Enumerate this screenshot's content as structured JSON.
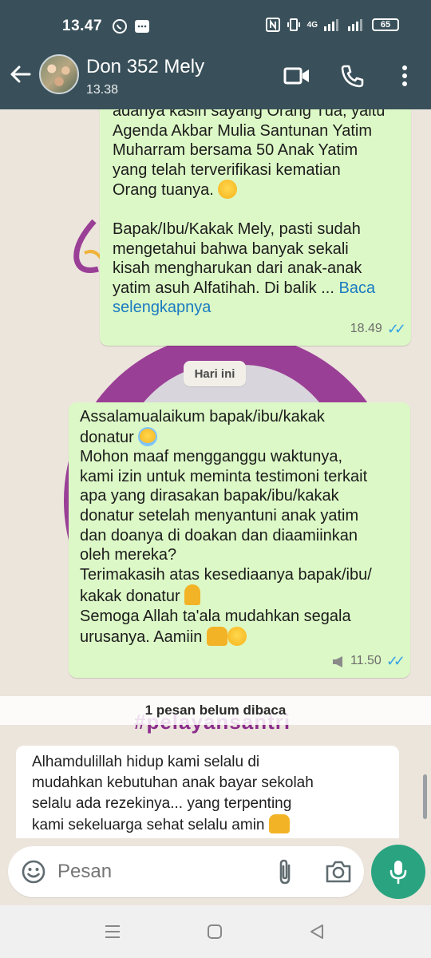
{
  "status_bar": {
    "time": "13.47",
    "battery": "65",
    "network": "4G"
  },
  "header": {
    "contact_name": "Don 352 Mely",
    "subtitle": "13.38"
  },
  "messages": [
    {
      "lines": [
        "adanya kasih sayang Orang Tua, yaitu",
        "Agenda Akbar Mulia Santunan Yatim",
        "Muharram bersama 50 Anak Yatim",
        "yang telah terverifikasi kematian",
        "Orang tuanya."
      ],
      "lines2": [
        "Bapak/Ibu/Kakak Mely, pasti sudah",
        "mengetahui bahwa banyak sekali",
        "kisah mengharukan dari anak-anak",
        "yatim asuh Alfatihah. Di balik ..."
      ],
      "read_more": "Baca selengkapnya",
      "time": "18.49"
    },
    {
      "lines": [
        "Assalamualaikum bapak/ibu/kakak",
        "donatur",
        "Mohon maaf mengganggu waktunya,",
        "kami izin untuk meminta testimoni terkait",
        "apa yang dirasakan bapak/ibu/kakak",
        "donatur setelah menyantuni anak yatim",
        "dan doanya di doakan dan diaamiinkan",
        "oleh mereka?",
        "Terimakasih atas kesediaanya bapak/ibu/",
        "kakak donatur",
        "Semoga Allah ta'ala mudahkan segala",
        "urusanya. Aamiin"
      ],
      "time": "11.50"
    }
  ],
  "date_divider": "Hari ini",
  "unread_notice": "1 pesan belum dibaca",
  "background_text": "#pelayansantri",
  "reply_preview": {
    "lines": [
      "Alhamdulillah hidup kami selalu di",
      "mudahkan kebutuhan anak bayar sekolah",
      "selalu ada rezekinya... yang terpenting",
      "kami sekeluarga sehat selalu amin"
    ]
  },
  "composer": {
    "placeholder": "Pesan"
  },
  "colors": {
    "header": "#39505a",
    "bubble_outgoing": "#dcf8c6",
    "accent_green": "#2aa480",
    "read_ticks": "#36a3e6",
    "link": "#1a7bc2"
  }
}
